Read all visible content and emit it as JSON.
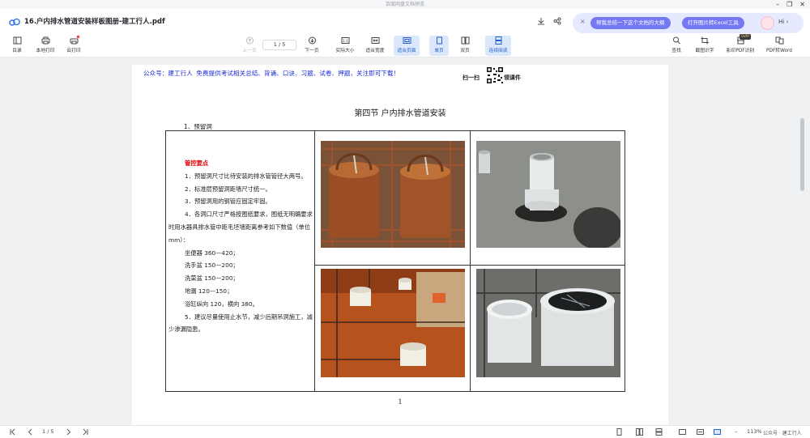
{
  "window": {
    "title": "百度网盘文档预览",
    "controls": [
      "–",
      "❐",
      "✕"
    ]
  },
  "tab": {
    "doc_title": "16.户内排水管道安装样板图册-建工行人.pdf"
  },
  "ai_bar": {
    "pill1": "帮我总结一下这个文档的大纲",
    "pill2": "打开图片转Excel工具",
    "greeting": "Hi",
    "close": "×",
    "chevron": "›"
  },
  "toolbar": {
    "catalog": "目录",
    "local_print": "本地打印",
    "cloud_print": "云打印",
    "prev_page": "上一页",
    "page_indicator": "1 / 5",
    "next_page": "下一页",
    "actual_size": "实际大小",
    "fit_width": "适合宽度",
    "fit_page": "适合页面",
    "single_page": "单页",
    "double_page": "双页",
    "continuous": "连续阅读",
    "search": "查找",
    "screenshot_ocr": "截图识字",
    "ocr_pdf": "影印PDF识别",
    "pdf_to_word": "PDF转Word",
    "svip_badge": "SVIP"
  },
  "document": {
    "header_note": "公众号：建工行人 免费提供考试相关总结、背诵、口诀、习题、试卷、押题，关注即可下载！",
    "scan_label_left": "扫一扫",
    "scan_label_right": "领课件",
    "section_title": "第四节 户内排水管道安装",
    "subheading": "1、预留洞",
    "notes_heading": "管控要点",
    "notes": [
      "1．预留洞尺寸比待安装的排水管管径大两号。",
      "2．标准层预留洞距墙尺寸统一。",
      "3．预留洞用的钢管应固定牢固。",
      "4．各洞口尺寸严格按图纸要求，图纸无明确要求时用水器具排水管中距毛坯墙距离参考如下数值（单位mm）："
    ],
    "values": [
      "坐便器 360—420；",
      "洗手盆 150—200；",
      "洗菜盆 150—200；",
      "地漏 120—150；",
      "浴缸纵向 120，横向 380。"
    ],
    "final_note": "5．建议尽量使用止水节，减少后期吊洞施工，减少渗漏隐患。",
    "page_number": "1"
  },
  "statusbar": {
    "page_indicator": "1 / 5",
    "zoom": "113%",
    "watermark": "公众号 · 建工行人"
  }
}
